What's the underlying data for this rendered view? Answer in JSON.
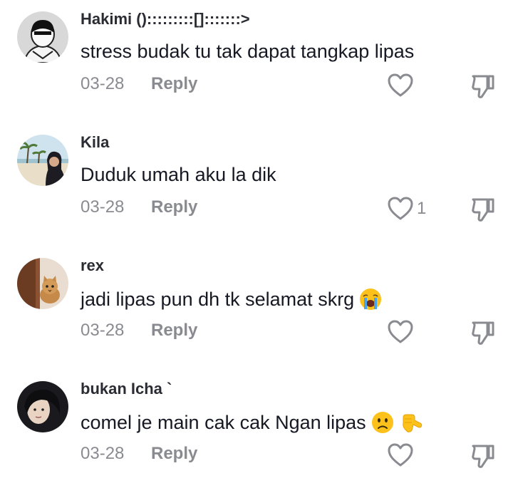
{
  "comments": [
    {
      "username": "Hakimi ():::::::::[]:::::::>",
      "text": "stress budak tu tak dapat tangkap lipas",
      "date": "03-28",
      "reply_label": "Reply",
      "like_count": "",
      "avatar_icon": "masked-person-avatar"
    },
    {
      "username": "Kila",
      "text": "Duduk umah aku la dik",
      "date": "03-28",
      "reply_label": "Reply",
      "like_count": "1",
      "avatar_icon": "beach-photo-avatar"
    },
    {
      "username": "rex",
      "text": "jadi lipas pun dh tk selamat skrg",
      "date": "03-28",
      "reply_label": "Reply",
      "like_count": "",
      "avatar_icon": "cat-photo-avatar",
      "emojis": [
        "crying-face-emoji"
      ]
    },
    {
      "username": "bukan Icha `",
      "text": "comel je main cak cak Ngan lipas",
      "date": "03-28",
      "reply_label": "Reply",
      "like_count": "",
      "avatar_icon": "person-photo-avatar",
      "emojis": [
        "worried-face-emoji",
        "pointing-hand-emoji"
      ]
    }
  ],
  "colors": {
    "username": "#2a2b33",
    "text": "#161823",
    "muted": "#8a8b91"
  }
}
